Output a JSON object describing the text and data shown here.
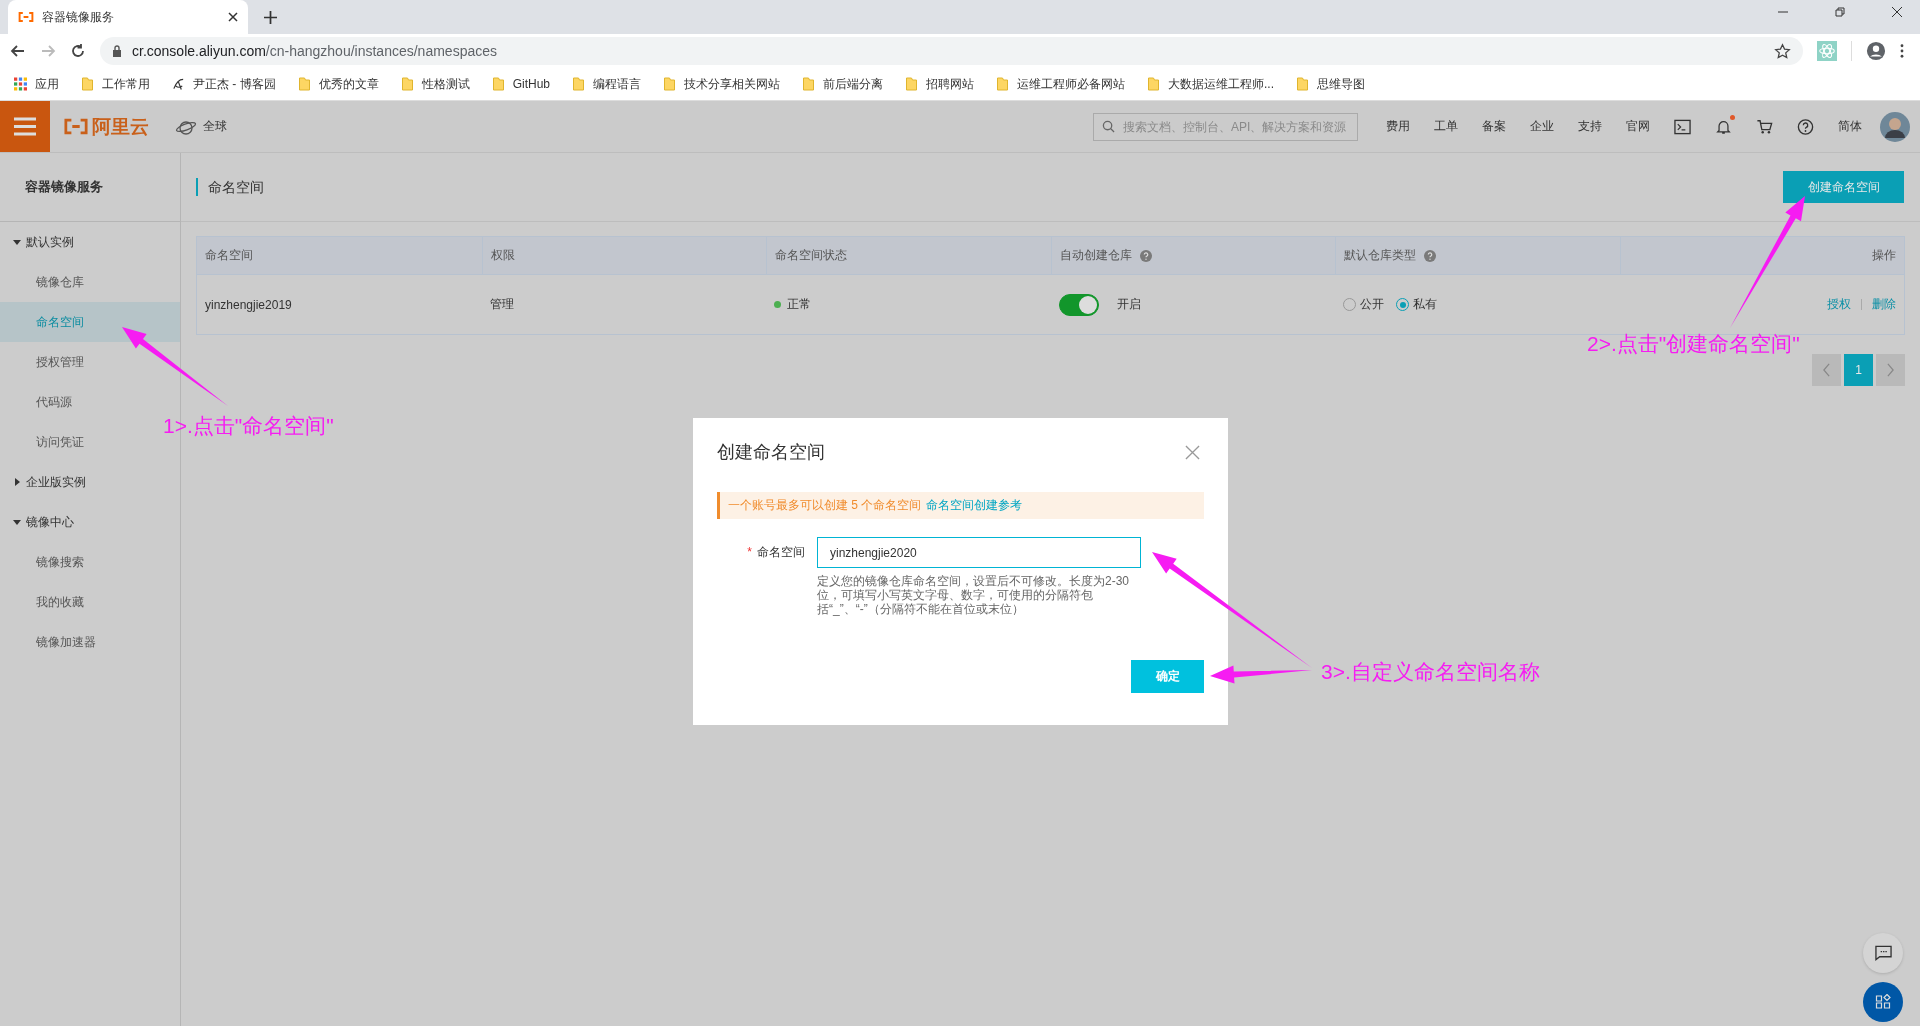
{
  "browser": {
    "tab_title": "容器镜像服务",
    "url_host": "cr.console.aliyun.com",
    "url_path": "/cn-hangzhou/instances/namespaces",
    "forward_disabled": true,
    "bookmarks": [
      {
        "kind": "apps",
        "label": "应用"
      },
      {
        "kind": "folder",
        "label": "工作常用"
      },
      {
        "kind": "site",
        "label": "尹正杰 - 博客园"
      },
      {
        "kind": "folder",
        "label": "优秀的文章"
      },
      {
        "kind": "folder",
        "label": "性格测试"
      },
      {
        "kind": "folder",
        "label": "GitHub"
      },
      {
        "kind": "folder",
        "label": "编程语言"
      },
      {
        "kind": "folder",
        "label": "技术分享相关网站"
      },
      {
        "kind": "folder",
        "label": "前后端分离"
      },
      {
        "kind": "folder",
        "label": "招聘网站"
      },
      {
        "kind": "folder",
        "label": "运维工程师必备网站"
      },
      {
        "kind": "folder",
        "label": "大数据运维工程师..."
      },
      {
        "kind": "folder",
        "label": "思维导图"
      }
    ]
  },
  "topbar": {
    "logo": "阿里云",
    "region": "全球",
    "search": {
      "placeholder": "搜索文档、控制台、API、解决方案和资源"
    },
    "links": [
      "费用",
      "工单",
      "备案",
      "企业",
      "支持",
      "官网"
    ],
    "notification_unread": true,
    "language": "简体"
  },
  "sidebar": {
    "title": "容器镜像服务",
    "groups": [
      {
        "label": "默认实例",
        "expanded": true,
        "items": [
          {
            "label": "镜像仓库",
            "selected": false
          },
          {
            "label": "命名空间",
            "selected": true
          },
          {
            "label": "授权管理",
            "selected": false
          },
          {
            "label": "代码源",
            "selected": false
          },
          {
            "label": "访问凭证",
            "selected": false
          }
        ]
      },
      {
        "label": "企业版实例",
        "expanded": false
      },
      {
        "label": "镜像中心",
        "expanded": true,
        "items": [
          {
            "label": "镜像搜索",
            "selected": false
          },
          {
            "label": "我的收藏",
            "selected": false
          },
          {
            "label": "镜像加速器",
            "selected": false
          }
        ]
      }
    ]
  },
  "page": {
    "title": "命名空间",
    "create_button": "创建命名空间"
  },
  "table": {
    "columns": [
      {
        "label": "命名空间",
        "help": false
      },
      {
        "label": "权限",
        "help": false
      },
      {
        "label": "命名空间状态",
        "help": false
      },
      {
        "label": "自动创建仓库",
        "help": true
      },
      {
        "label": "默认仓库类型",
        "help": true
      },
      {
        "label": "操作",
        "help": false
      }
    ],
    "rows": [
      {
        "name": "yinzhengjie2019",
        "permission": "管理",
        "status": "正常",
        "color": "#4caf50",
        "auto_create": {
          "on": true,
          "label": "开启"
        },
        "repo_type": [
          {
            "label": "公开",
            "selected": false
          },
          {
            "label": "私有",
            "selected": true
          }
        ],
        "actions": [
          "授权",
          "删除"
        ]
      }
    ]
  },
  "pagination": {
    "pages": [
      {
        "label": "1",
        "selected": true
      }
    ]
  },
  "dialog": {
    "title": "创建命名空间",
    "notice": "一个账号最多可以创建 5 个命名空间",
    "notice_link": "命名空间创建参考",
    "field": {
      "label": "命名空间",
      "required_mark": "*",
      "value": "yinzhengjie2020",
      "help": "定义您的镜像仓库命名空间，设置后不可修改。长度为2-30位，可填写小写英文字母、数字，可使用的分隔符包括“_”、“-”（分隔符不能在首位或末位）"
    },
    "ok_button": "确定"
  },
  "annotations": [
    {
      "text": "1>.点击\"命名空间\""
    },
    {
      "text": "2>.点击\"创建命名空间\""
    },
    {
      "text": "3>.自定义命名空间名称"
    }
  ]
}
